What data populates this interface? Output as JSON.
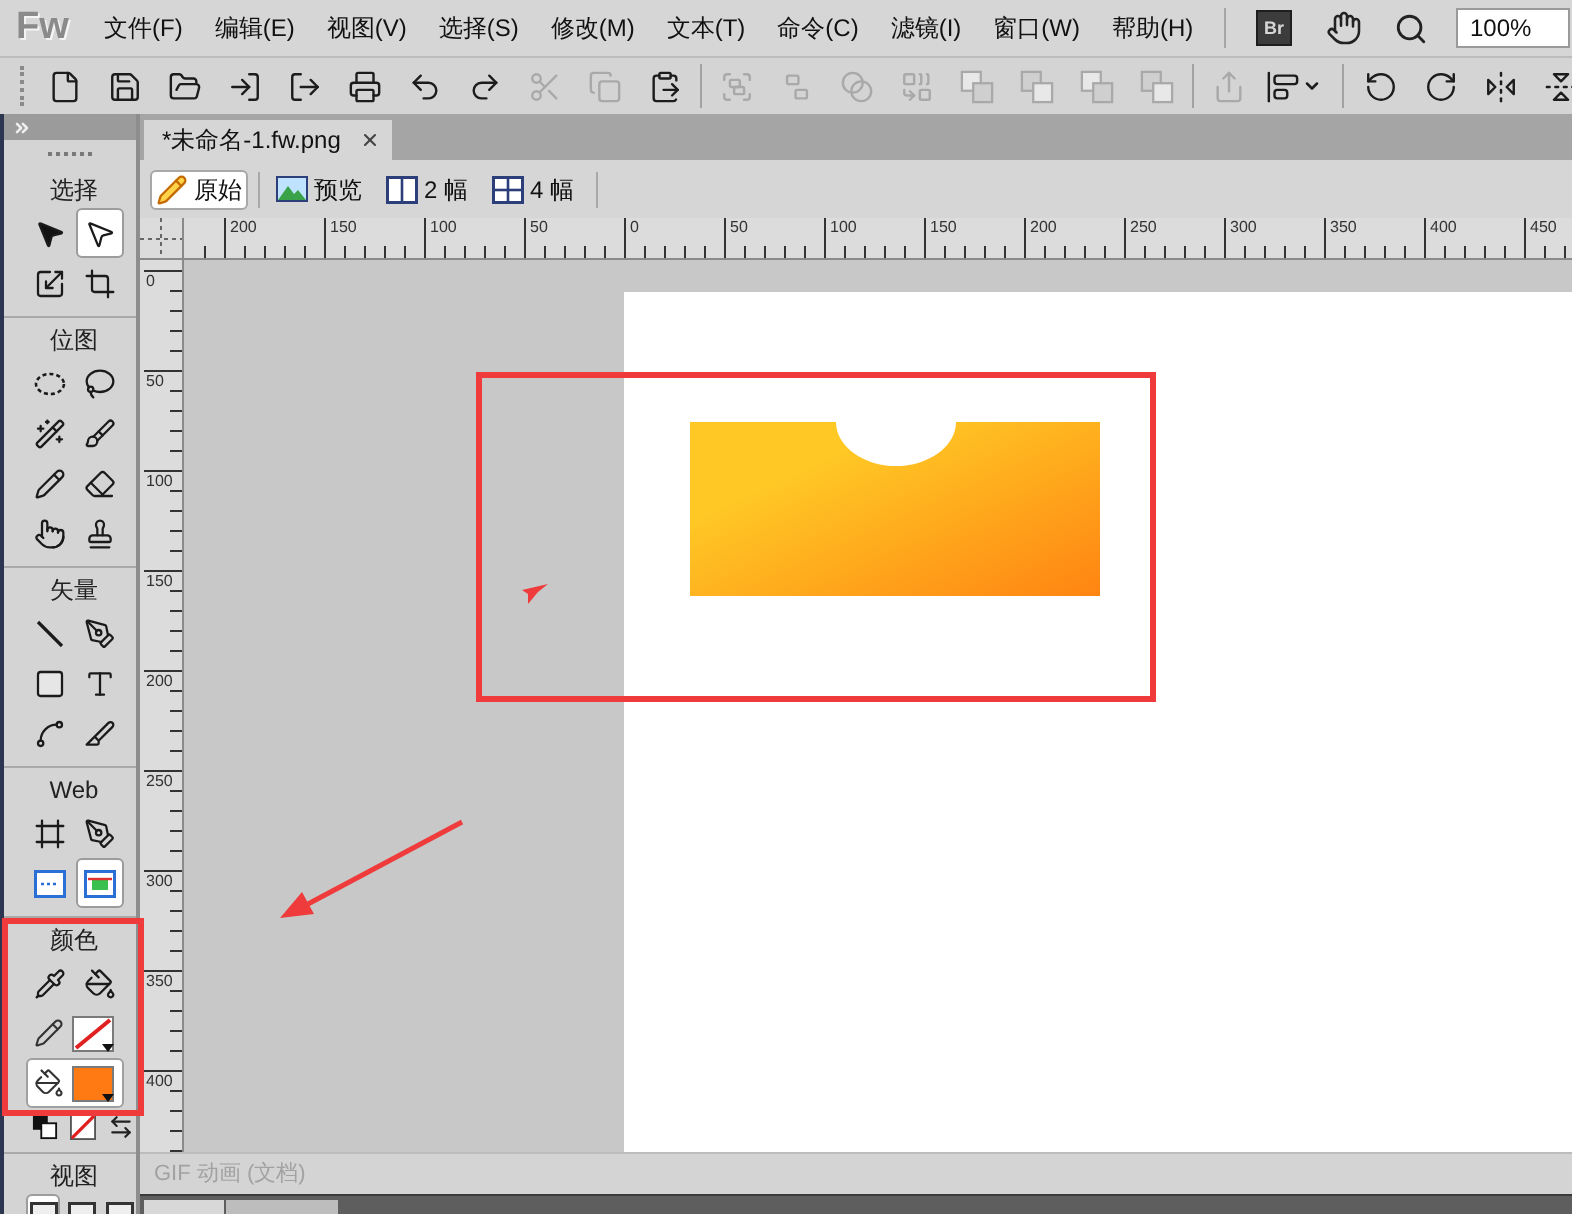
{
  "app_bar": {
    "logo": "Fw",
    "menus": [
      "文件(F)",
      "编辑(E)",
      "视图(V)",
      "选择(S)",
      "修改(M)",
      "文本(T)",
      "命令(C)",
      "滤镜(I)",
      "窗口(W)",
      "帮助(H)"
    ],
    "launch_button": "Br",
    "zoom": "100%"
  },
  "toolbar_groups": [
    [
      {
        "disabled": false
      },
      {
        "disabled": false
      },
      {
        "disabled": false
      },
      {
        "disabled": false
      },
      {
        "disabled": false
      },
      {
        "disabled": false
      },
      {
        "disabled": false
      },
      {
        "disabled": false
      },
      {
        "disabled": true
      },
      {
        "disabled": true
      },
      {
        "disabled": false
      }
    ],
    [
      {
        "disabled": true
      },
      {
        "disabled": true
      },
      {
        "disabled": true
      },
      {
        "disabled": true
      },
      {
        "disabled": true
      },
      {
        "disabled": true
      },
      {
        "disabled": true
      },
      {
        "disabled": true
      }
    ],
    [
      {
        "disabled": true
      },
      {
        "disabled": false
      }
    ],
    [
      {
        "disabled": false
      },
      {
        "disabled": false
      },
      {
        "disabled": false
      },
      {
        "disabled": false
      }
    ]
  ],
  "tool_sections": [
    {
      "label": "选择",
      "tools": [
        {
          "selected": false
        },
        {
          "selected": true
        },
        {
          "selected": false
        },
        {
          "selected": false
        }
      ]
    },
    {
      "label": "位图",
      "tools": [
        {
          "selected": false
        },
        {
          "selected": false
        },
        {
          "selected": false
        },
        {
          "selected": false
        },
        {
          "selected": false
        },
        {
          "selected": false
        },
        {
          "selected": false
        },
        {
          "selected": false
        }
      ]
    },
    {
      "label": "矢量",
      "tools": [
        {
          "selected": false
        },
        {
          "selected": false
        },
        {
          "selected": false
        },
        {
          "selected": false
        },
        {
          "selected": false
        },
        {
          "selected": false
        }
      ]
    },
    {
      "label": "Web",
      "tools": [
        {
          "selected": false
        },
        {
          "selected": false
        },
        {
          "selected": false
        },
        {
          "selected": true
        }
      ]
    }
  ],
  "color_section": {
    "label": "颜色",
    "tools": [
      {
        "selected": false
      },
      {
        "selected": false
      }
    ],
    "wells": [
      {
        "kind": "stroke",
        "none": true,
        "selected": false
      },
      {
        "kind": "fill",
        "none": false,
        "color": "#ff7a12",
        "selected": true
      }
    ]
  },
  "view_section": {
    "label": "视图",
    "modes": [
      {
        "selected": true
      },
      {
        "selected": false
      },
      {
        "selected": false
      }
    ]
  },
  "document_tabs": [
    {
      "label": "*未命名-1.fw.png",
      "selected": true
    }
  ],
  "view_tabs": [
    {
      "label": "原始",
      "selected": true
    },
    {
      "label": "预览",
      "selected": false
    },
    {
      "label": "2 幅",
      "selected": false
    },
    {
      "label": "4 幅",
      "selected": false
    }
  ],
  "rulers": {
    "horizontal": [
      "200",
      "150",
      "100",
      "50",
      "0",
      "50",
      "100",
      "150",
      "200",
      "250",
      "300",
      "350",
      "400",
      "450"
    ],
    "vertical": [
      "0",
      "50",
      "100",
      "150",
      "200",
      "250",
      "300",
      "350",
      "400"
    ]
  },
  "status_bar": {
    "text": "GIF 动画 (文档)"
  }
}
